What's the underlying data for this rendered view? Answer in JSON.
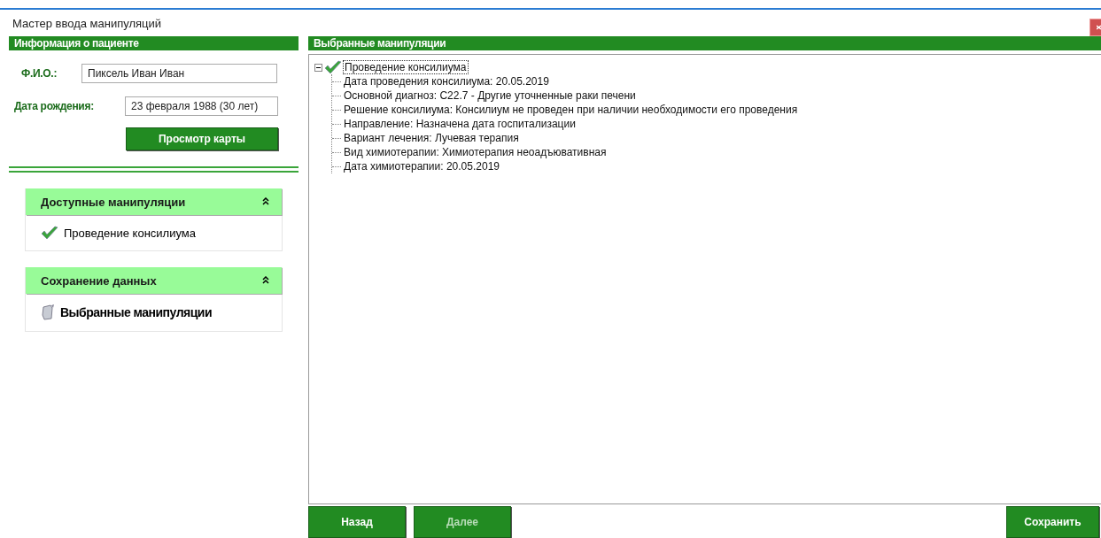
{
  "window": {
    "title": "Мастер ввода манипуляций"
  },
  "patient_panel": {
    "title": "Информация о пациенте",
    "fields": [
      {
        "label": "Ф.И.О.:",
        "value": "Пиксель Иван Иван"
      },
      {
        "label": "Дата рождения:",
        "value": "23 февраля 1988 (30 лет)"
      }
    ],
    "button": "Просмотр карты"
  },
  "groups": [
    {
      "title": "Доступные манипуляции",
      "expanded": true,
      "items": [
        {
          "label": "Проведение консилиума",
          "kind": "check"
        }
      ]
    },
    {
      "title": "Сохранение данных",
      "expanded": true,
      "items": [
        {
          "label": "Выбранные манипуляции",
          "kind": "save"
        }
      ]
    }
  ],
  "selected_panel": {
    "title": "Выбранные манипуляции",
    "tree": [
      {
        "label": "Проведение консилиума",
        "expanded": true,
        "selected": true,
        "children": [
          {
            "label": "Дата проведения консилиума: 20.05.2019"
          },
          {
            "label": "Основной диагноз: C22.7 - Другие уточненные раки печени"
          },
          {
            "label": "Решение консилиума: Консилиум не проведен при наличии необходимости его проведения"
          },
          {
            "label": "Направление: Назначена дата госпитализации"
          },
          {
            "label": "Вариант лечения: Лучевая терапия"
          },
          {
            "label": "Вид химиотерапии: Химиотерапия неоадъювативная"
          },
          {
            "label": "Дата химиотерапии: 20.05.2019"
          }
        ]
      }
    ]
  },
  "buttons": [
    {
      "label": "Назад",
      "disabled": false
    },
    {
      "label": "Далее",
      "disabled": true
    },
    {
      "label": "Сохранить",
      "disabled": false
    }
  ]
}
